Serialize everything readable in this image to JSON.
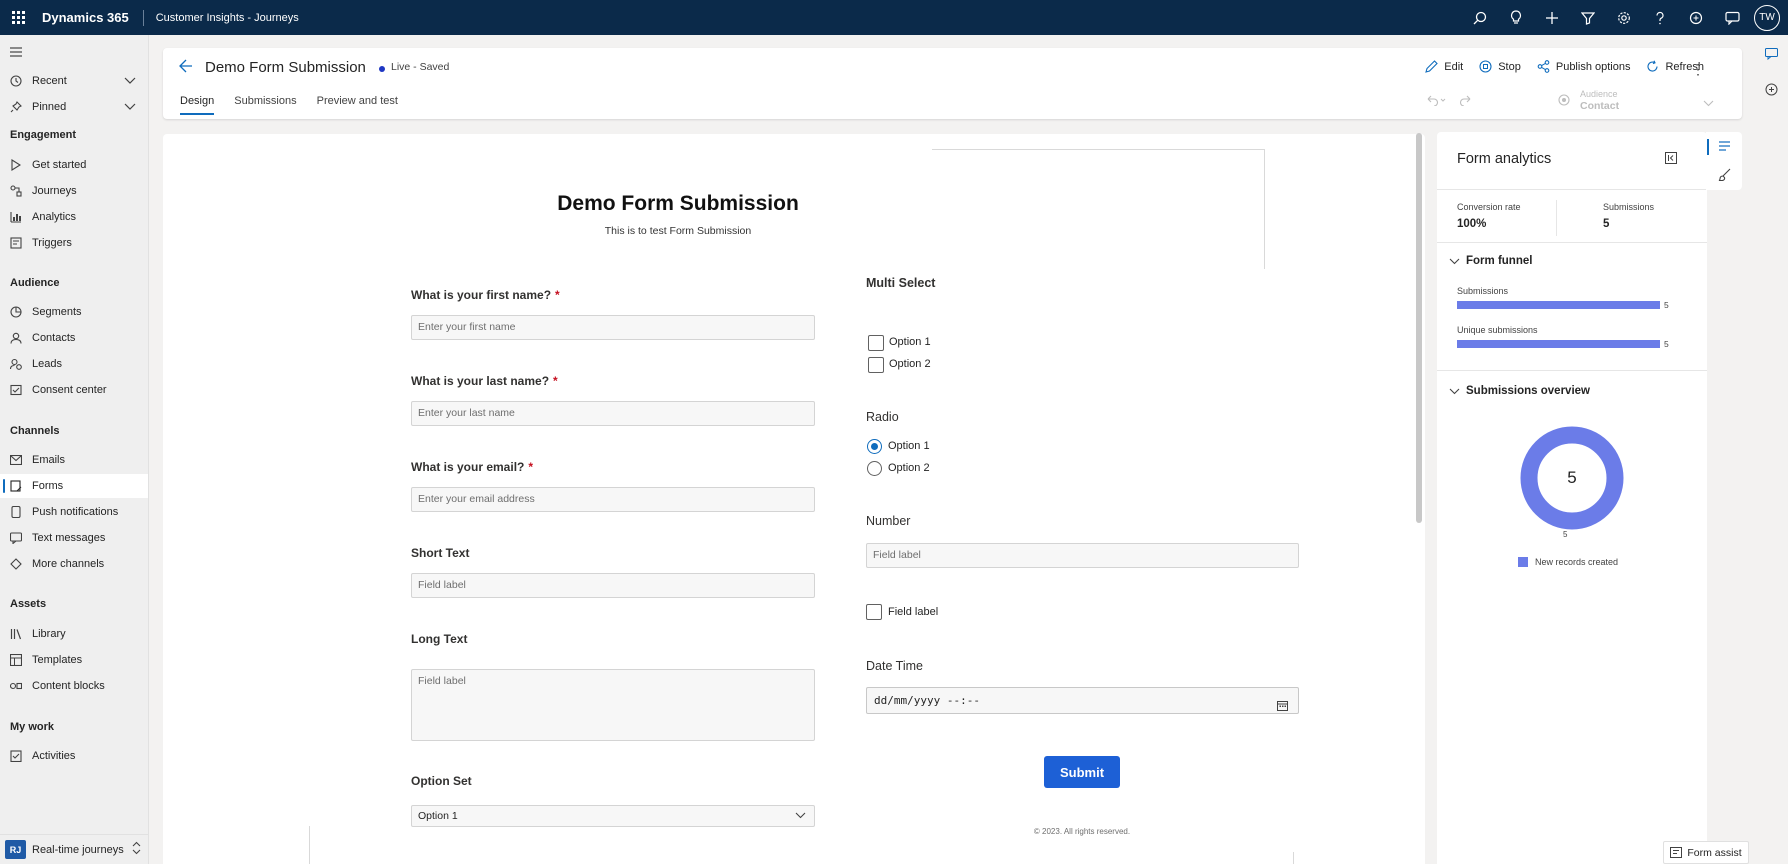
{
  "topbar": {
    "brand": "Dynamics 365",
    "app_name": "Customer Insights - Journeys",
    "user_initials": "TW"
  },
  "nav": {
    "recent": "Recent",
    "pinned": "Pinned",
    "sections": [
      {
        "heading": "Engagement",
        "items": [
          "Get started",
          "Journeys",
          "Analytics",
          "Triggers"
        ]
      },
      {
        "heading": "Audience",
        "items": [
          "Segments",
          "Contacts",
          "Leads",
          "Consent center"
        ]
      },
      {
        "heading": "Channels",
        "items": [
          "Emails",
          "Forms",
          "Push notifications",
          "Text messages",
          "More channels"
        ]
      },
      {
        "heading": "Assets",
        "items": [
          "Library",
          "Templates",
          "Content blocks"
        ]
      },
      {
        "heading": "My work",
        "items": [
          "Activities"
        ]
      }
    ],
    "selected": "Forms",
    "area": {
      "badge": "RJ",
      "label": "Real-time journeys"
    }
  },
  "header": {
    "title": "Demo Form Submission",
    "status": "Live - Saved",
    "tabs": [
      "Design",
      "Submissions",
      "Preview and test"
    ],
    "active_tab": "Design",
    "commands": {
      "edit": "Edit",
      "stop": "Stop",
      "publish": "Publish options",
      "refresh": "Refresh"
    },
    "audience_label": "Audience",
    "audience_value": "Contact"
  },
  "form": {
    "title": "Demo Form Submission",
    "subtitle": "This is to test Form Submission",
    "first_name": {
      "label": "What is your first name?",
      "required": "*",
      "placeholder": "Enter your first name"
    },
    "last_name": {
      "label": "What is your last name?",
      "required": "*",
      "placeholder": "Enter your last name"
    },
    "email": {
      "label": "What is your email?",
      "required": "*",
      "placeholder": "Enter your email address"
    },
    "short_text": {
      "label": "Short Text",
      "placeholder": "Field label"
    },
    "long_text": {
      "label": "Long Text",
      "placeholder": "Field label"
    },
    "option_set": {
      "label": "Option Set",
      "value": "Option 1"
    },
    "multi_select": {
      "label": "Multi Select",
      "options": [
        "Option 1",
        "Option 2"
      ]
    },
    "radio": {
      "label": "Radio",
      "options": [
        "Option 1",
        "Option 2"
      ],
      "selected": "Option 1"
    },
    "number": {
      "label": "Number",
      "placeholder": "Field label"
    },
    "checkbox_label": "Field label",
    "date_time": {
      "label": "Date Time",
      "value": "dd/mm/yyyy --:--"
    },
    "submit": "Submit",
    "copyright": "© 2023. All rights reserved."
  },
  "analytics": {
    "title": "Form analytics",
    "conversion_rate_label": "Conversion rate",
    "conversion_rate": "100%",
    "submissions_label": "Submissions",
    "submissions": "5",
    "funnel_title": "Form funnel",
    "funnel": [
      {
        "label": "Submissions",
        "value": 5
      },
      {
        "label": "Unique submissions",
        "value": 5
      }
    ],
    "overview_title": "Submissions overview",
    "donut_total": "5",
    "donut_segment_value": "5",
    "legend": "New records created",
    "accent": "#6b7ce8"
  },
  "form_assist": "Form assist"
}
